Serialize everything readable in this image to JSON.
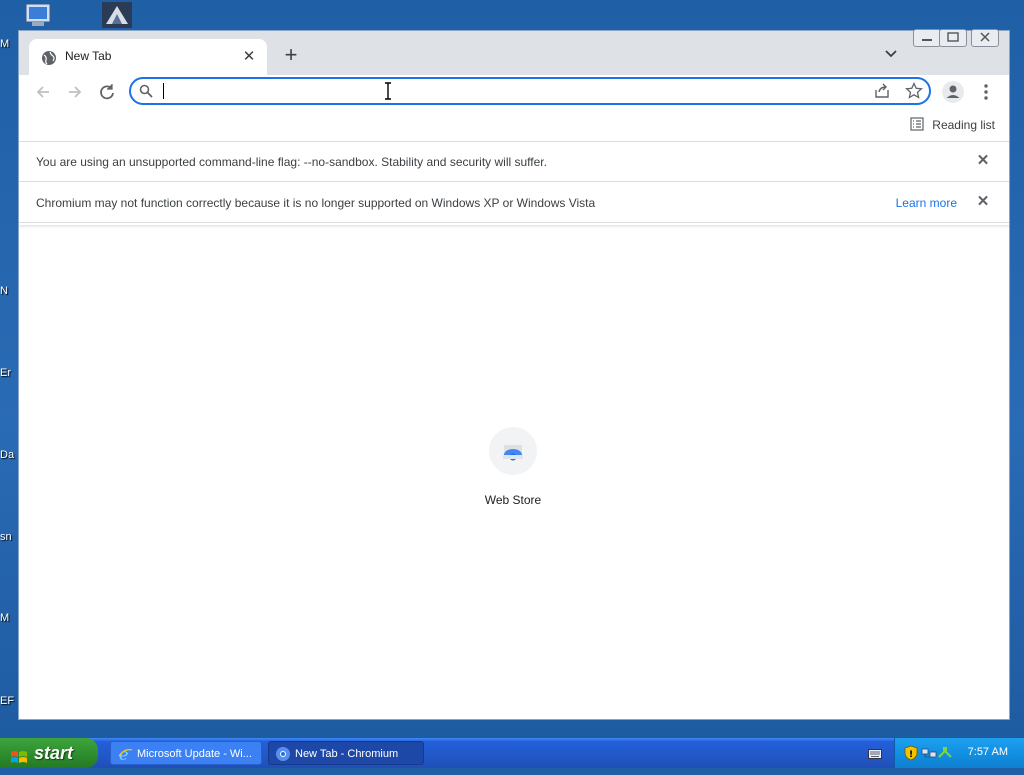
{
  "desktop": {
    "labels": [
      "M",
      "N",
      "Er",
      "Da",
      "sn",
      "M",
      "EF"
    ]
  },
  "browser": {
    "tab": {
      "title": "New Tab"
    },
    "omnibox": {
      "value": "",
      "placeholder": ""
    },
    "bookmarks_bar": {
      "reading_list_label": "Reading list"
    },
    "infobars": [
      {
        "message": "You are using an unsupported command-line flag: --no-sandbox. Stability and security will suffer.",
        "link": ""
      },
      {
        "message": "Chromium may not function correctly because it is no longer supported on Windows XP or Windows Vista",
        "link": "Learn more"
      }
    ],
    "shortcuts": [
      {
        "label": "Web Store"
      }
    ]
  },
  "taskbar": {
    "start_label": "start",
    "tasks": [
      {
        "label": "Microsoft Update - Wi..."
      },
      {
        "label": "New Tab - Chromium"
      }
    ],
    "clock": "7:57 AM"
  },
  "colors": {
    "accent": "#1a73e8",
    "desktop": "#2a6bb5",
    "tabstrip": "#dee1e6",
    "start_green": "#2f8f2f"
  }
}
